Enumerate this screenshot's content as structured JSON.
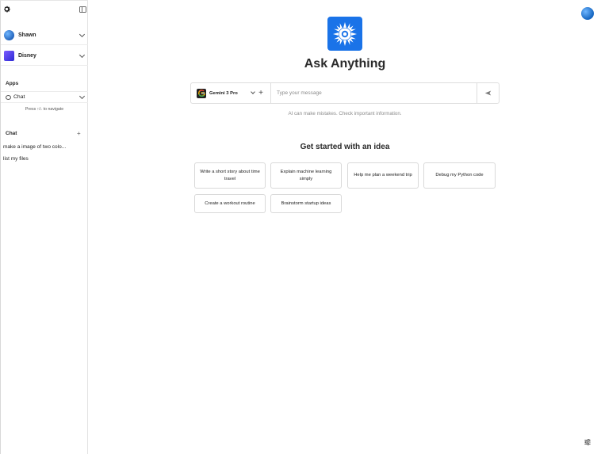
{
  "sidebar": {
    "accounts": [
      {
        "name": "Shawn",
        "color": "#2f7fd6"
      },
      {
        "name": "Disney",
        "color": "#5b3fd6"
      }
    ],
    "apps_title": "Apps",
    "app_selected": "Chat",
    "nav_hint": "Press ↑/↓ to navigate",
    "chat_title": "Chat",
    "chat_add_label": "+",
    "chats": [
      "make a image of two colo...",
      "list my files"
    ]
  },
  "main": {
    "headline": "Ask Anything",
    "model": "Gemini 3 Pro",
    "message_placeholder": "Type your message",
    "message_value": "",
    "disclaimer": "AI can make mistakes. Check important information.",
    "ideas_title": "Get started with an idea",
    "ideas": [
      "Write a short story about time travel",
      "Explain machine learning simply",
      "Help me plan a weekend trip",
      "Debug my Python code",
      "Create a workout routine",
      "Brainstorm startup ideas"
    ]
  },
  "colors": {
    "accent": "#1a73e8"
  },
  "icons": [
    "gear-icon",
    "sidebar-toggle-icon",
    "chevron-down-icon",
    "chat-bubble-icon",
    "plus-icon",
    "sun-logo-icon",
    "google-logo-icon",
    "send-icon",
    "user-avatar",
    "settings-sliders-icon"
  ]
}
